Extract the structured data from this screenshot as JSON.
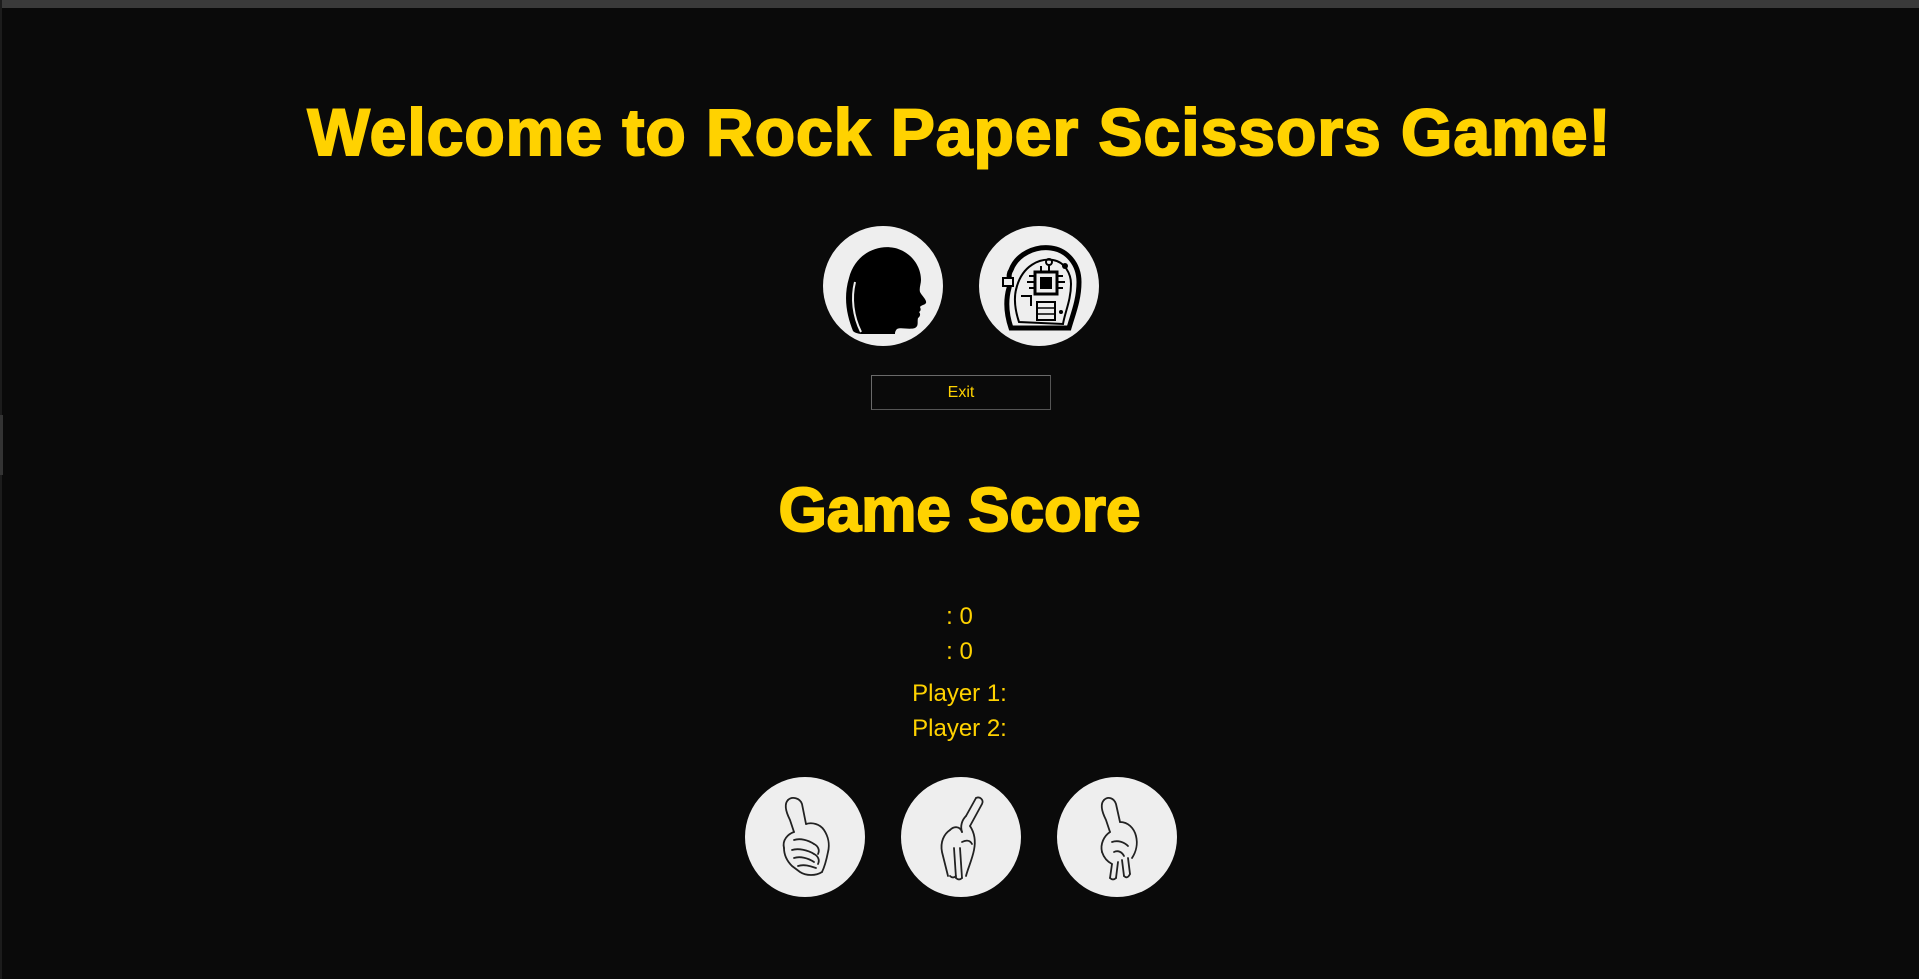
{
  "header": {
    "title": "Welcome to Rock Paper Scissors Game!"
  },
  "modes": [
    {
      "name": "human",
      "icon": "human-head-icon"
    },
    {
      "name": "ai",
      "icon": "robot-head-icon"
    }
  ],
  "controls": {
    "exit_label": "Exit"
  },
  "score": {
    "title": "Game Score",
    "line1": ": 0",
    "line2": ": 0",
    "player1_label": "Player 1:",
    "player2_label": "Player 2:"
  },
  "choices": [
    {
      "name": "rock",
      "icon": "rock-fist-icon"
    },
    {
      "name": "paper",
      "icon": "paper-hand-icon"
    },
    {
      "name": "scissors",
      "icon": "scissors-hand-icon"
    }
  ],
  "colors": {
    "background": "#0a0a0a",
    "accent": "#ffd200",
    "circle": "#eeeeee"
  }
}
